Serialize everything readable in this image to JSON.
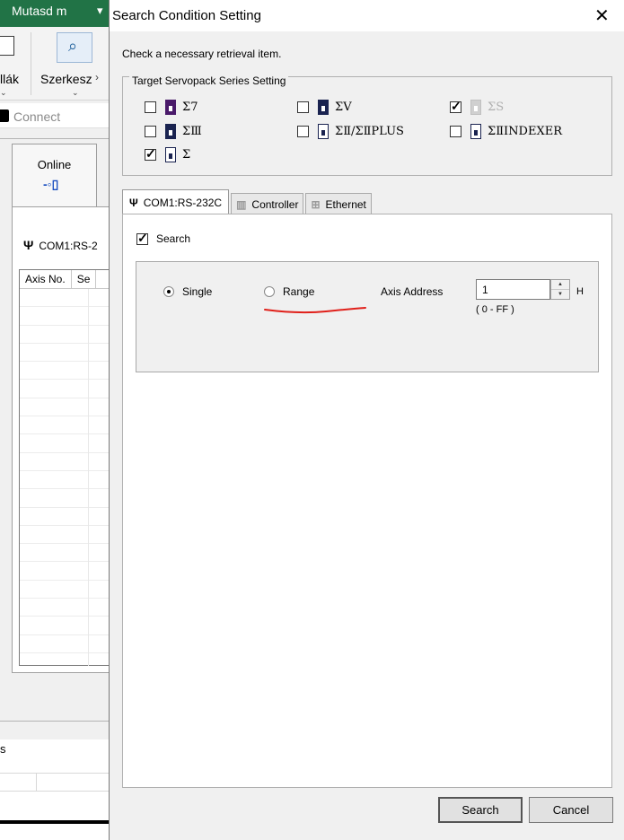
{
  "background_app": {
    "ribbon_tab": "Mutasd m",
    "ribbon_label_1": "llák",
    "ribbon_label_2": "Szerkesz",
    "connect_title": "Connect",
    "online_label": "Online",
    "com_label": "COM1:RS-2",
    "table_headers": [
      "Axis No.",
      "Se"
    ],
    "bottom_text": "s"
  },
  "dialog": {
    "title": "Search Condition Setting",
    "close_label": "✕",
    "instruction": "Check a necessary retrieval item.",
    "servopack_group": {
      "legend": "Target Servopack Series Setting",
      "items": [
        {
          "name": "Σ7",
          "checked": false,
          "enabled": true
        },
        {
          "name": "ΣV",
          "checked": false,
          "enabled": true
        },
        {
          "name": "ΣS",
          "checked": true,
          "enabled": false
        },
        {
          "name": "ΣⅢ",
          "checked": false,
          "enabled": true
        },
        {
          "name": "ΣⅡ/ΣⅡPLUS",
          "checked": false,
          "enabled": true
        },
        {
          "name": "ΣⅡINDEXER",
          "checked": false,
          "enabled": true
        },
        {
          "name": "Σ",
          "checked": true,
          "enabled": true
        }
      ]
    },
    "tabs": [
      {
        "label": "COM1:RS-232C",
        "icon": "plug-icon",
        "active": true
      },
      {
        "label": "Controller",
        "icon": "controller-icon",
        "active": false
      },
      {
        "label": "Ethernet",
        "icon": "network-icon",
        "active": false
      }
    ],
    "search_checkbox": {
      "label": "Search",
      "checked": true
    },
    "mode": {
      "single_label": "Single",
      "range_label": "Range",
      "selected": "Single"
    },
    "axis_address": {
      "label": "Axis Address",
      "value": "1",
      "unit": "H",
      "range": "( 0 - FF )"
    },
    "annotation_color": "#e0201a",
    "buttons": {
      "search": "Search",
      "cancel": "Cancel"
    }
  }
}
